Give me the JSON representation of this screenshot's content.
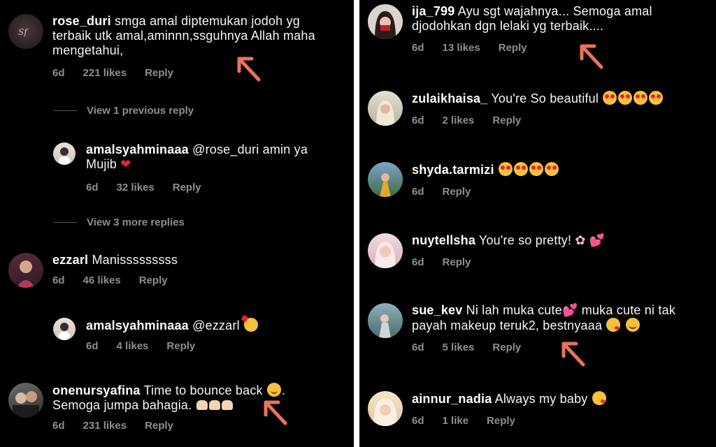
{
  "left_comments": [
    {
      "username": "rose_duri",
      "text": "smga amal diptemukan jodoh yg terbaik utk amal,aminnn,ssguhnya Allah maha mengetahui,",
      "age": "6d",
      "likes": "221 likes",
      "reply": "Reply"
    },
    {
      "username": "amalsyahminaaa",
      "text": "@rose_duri amin ya Mujib",
      "age": "6d",
      "likes": "32 likes",
      "reply": "Reply"
    },
    {
      "username": "ezzarl",
      "text": "Manisssssssss",
      "age": "6d",
      "likes": "46 likes",
      "reply": "Reply"
    },
    {
      "username": "amalsyahminaaa",
      "text": "@ezzarl",
      "age": "6d",
      "likes": "4 likes",
      "reply": "Reply"
    },
    {
      "username": "onenursyafina",
      "text": "Time to bounce back",
      "text2": "Semoga jumpa bahagia.",
      "age": "6d",
      "likes": "231 likes",
      "reply": "Reply"
    }
  ],
  "view_replies": {
    "previous": "View 1 previous reply",
    "more": "View 3 more replies"
  },
  "right_comments": [
    {
      "username": "ija_799",
      "text": "Ayu sgt wajahnya... Semoga amal djodohkan dgn lelaki yg terbaik....",
      "age": "6d",
      "likes": "13 likes",
      "reply": "Reply"
    },
    {
      "username": "zulaikhaisa_",
      "text": "You're So beautiful",
      "age": "6d",
      "likes": "2 likes",
      "reply": "Reply"
    },
    {
      "username": "shyda.tarmizi",
      "text": "",
      "age": "6d",
      "reply": "Reply"
    },
    {
      "username": "nuytellsha",
      "text": "You're so pretty!",
      "age": "6d",
      "reply": "Reply"
    },
    {
      "username": "sue_kev",
      "text": "Ni lah muka cute",
      "text2": "muka cute ni tak payah makeup teruk2, bestnyaaa",
      "age": "6d",
      "likes": "5 likes",
      "reply": "Reply"
    },
    {
      "username": "ainnur_nadia",
      "text": "Always my baby",
      "age": "6d",
      "likes": "1 like",
      "reply": "Reply"
    }
  ],
  "colors": {
    "background": "#000000",
    "muted_text": "#8e8e8e",
    "arrow": "#e8735a"
  }
}
